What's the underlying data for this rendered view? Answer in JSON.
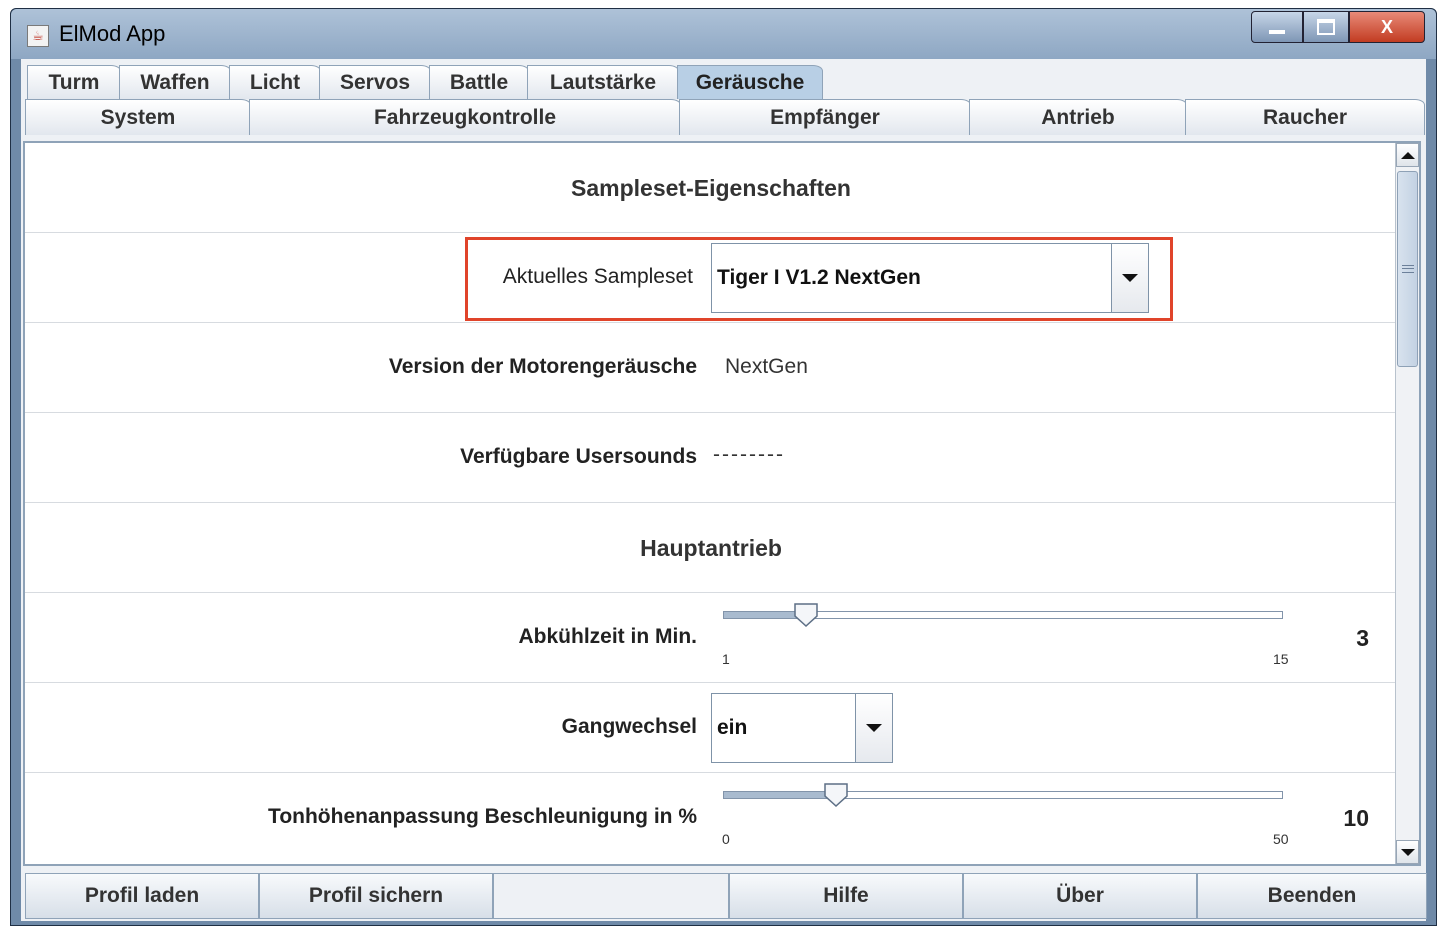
{
  "window": {
    "title": "ElMod App",
    "minimize_icon": "minimize-icon",
    "maximize_icon": "maximize-icon",
    "close_label": "X"
  },
  "tabs_row1": [
    {
      "label": "Turm"
    },
    {
      "label": "Waffen"
    },
    {
      "label": "Licht"
    },
    {
      "label": "Servos"
    },
    {
      "label": "Battle"
    },
    {
      "label": "Lautstärke"
    },
    {
      "label": "Geräusche",
      "active": true
    }
  ],
  "tabs_row2": [
    {
      "label": "System"
    },
    {
      "label": "Fahrzeugkontrolle"
    },
    {
      "label": "Empfänger"
    },
    {
      "label": "Antrieb"
    },
    {
      "label": "Raucher"
    }
  ],
  "content": {
    "sampleset_title": "Sampleset-Eigenschaften",
    "current_sampleset_label": "Aktuelles Sampleset",
    "current_sampleset_value": "Tiger I V1.2 NextGen",
    "engine_version_label": "Version der Motorengeräusche",
    "engine_version_value": "NextGen",
    "usersounds_label": "Verfügbare Usersounds",
    "usersounds_value": "--------",
    "main_drive_title": "Hauptantrieb",
    "cooldown": {
      "label": "Abkühlzeit in Min.",
      "value": "3",
      "min": "1",
      "max": "15"
    },
    "gear_change": {
      "label": "Gangwechsel",
      "value": "ein"
    },
    "pitch_accel": {
      "label": "Tonhöhenanpassung Beschleunigung in %",
      "value": "10",
      "min": "0",
      "max": "50"
    }
  },
  "bottom_buttons": {
    "load": "Profil laden",
    "save": "Profil sichern",
    "help": "Hilfe",
    "about": "Über",
    "exit": "Beenden"
  },
  "colors": {
    "highlight": "#e0442a",
    "active_tab": "#b8cfe5"
  }
}
